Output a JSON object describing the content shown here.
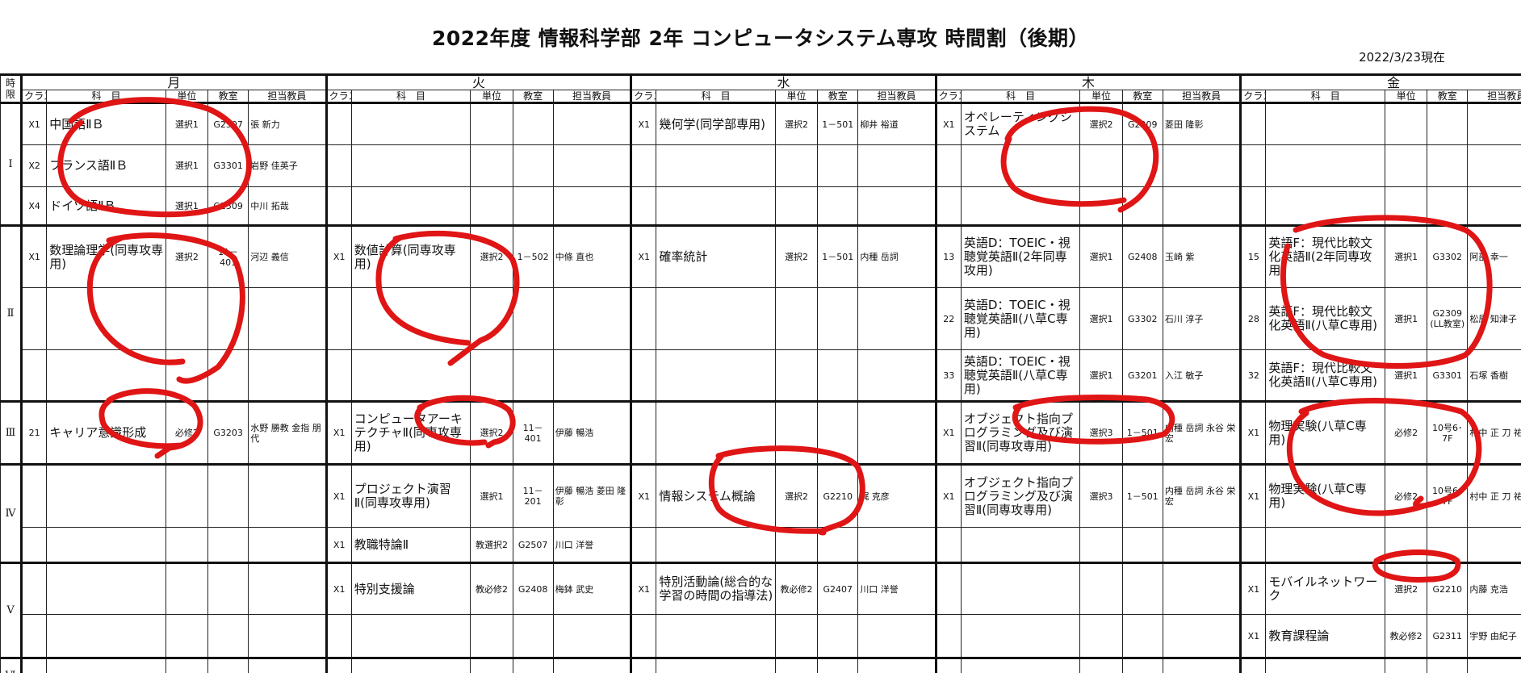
{
  "title": "2022年度 情報科学部 2年 コンピュータシステム専攻 時間割（後期）",
  "as_of": "2022/3/23現在",
  "header": {
    "period_label": "時限",
    "days": [
      "月",
      "火",
      "水",
      "木",
      "金"
    ],
    "cols": {
      "class": "クラス",
      "subject": "科　目",
      "units": "単位",
      "room": "教室",
      "teacher": "担当教員"
    }
  },
  "periods": [
    {
      "label": "Ⅰ",
      "rows": [
        [
          {
            "cls": "X1",
            "subject": "中国語ⅡＢ",
            "units": "選択1",
            "room": "G2507",
            "teacher": "張 新力"
          },
          {},
          {
            "cls": "X1",
            "subject": "幾何学(同学部専用)",
            "units": "選択2",
            "room": "1－501",
            "teacher": "柳井 裕道"
          },
          {
            "cls": "X1",
            "subject": "オペレーティングシステム",
            "units": "選択2",
            "room": "G2209",
            "teacher": "菱田 隆彰"
          },
          {}
        ],
        [
          {
            "cls": "X2",
            "subject": "フランス語ⅡＢ",
            "units": "選択1",
            "room": "G3301",
            "teacher": "岩野 佳英子"
          },
          {},
          {},
          {},
          {}
        ],
        [
          {
            "cls": "X4",
            "subject": "ドイツ語ⅡＢ",
            "units": "選択1",
            "room": "G2509",
            "teacher": "中川 拓哉"
          },
          {},
          {},
          {},
          {}
        ]
      ]
    },
    {
      "label": "Ⅱ",
      "rows": [
        [
          {
            "cls": "X1",
            "subject": "数理論理学(同専攻専用)",
            "units": "選択2",
            "room": "11－401",
            "teacher": "河辺 義信"
          },
          {
            "cls": "X1",
            "subject": "数値計算(同専攻専用)",
            "units": "選択2",
            "room": "1－502",
            "teacher": "中條 直也"
          },
          {
            "cls": "X1",
            "subject": "確率統計",
            "units": "選択2",
            "room": "1－501",
            "teacher": "内種 岳詞"
          },
          {
            "cls": "13",
            "subject": "英語D：TOEIC・視聴覚英語Ⅱ(2年同専攻用)",
            "units": "選択1",
            "room": "G2408",
            "teacher": "玉崎 紫"
          },
          {
            "cls": "15",
            "subject": "英語F：現代比較文化英語Ⅱ(2年同専攻用)",
            "units": "選択1",
            "room": "G3302",
            "teacher": "阿部 幸一"
          }
        ],
        [
          {},
          {},
          {},
          {
            "cls": "22",
            "subject": "英語D：TOEIC・視聴覚英語Ⅱ(八草C専用)",
            "units": "選択1",
            "room": "G3302",
            "teacher": "石川 淳子"
          },
          {
            "cls": "28",
            "subject": "英語F：現代比較文化英語Ⅱ(八草C専用)",
            "units": "選択1",
            "room": "G2309 (LL教室)",
            "teacher": "松原 知津子"
          }
        ],
        [
          {},
          {},
          {},
          {
            "cls": "33",
            "subject": "英語D：TOEIC・視聴覚英語Ⅱ(八草C専用)",
            "units": "選択1",
            "room": "G3201",
            "teacher": "入江 敏子"
          },
          {
            "cls": "32",
            "subject": "英語F：現代比較文化英語Ⅱ(八草C専用)",
            "units": "選択1",
            "room": "G3301",
            "teacher": "石塚 香樹"
          }
        ]
      ]
    },
    {
      "label": "Ⅲ",
      "rows": [
        [
          {
            "cls": "21",
            "subject": "キャリア意識形成",
            "units": "必修2",
            "room": "G3203",
            "teacher": "水野 勝教 金指 朋代"
          },
          {
            "cls": "X1",
            "subject": "コンピュータアーキテクチャⅡ(同専攻専用)",
            "units": "選択2",
            "room": "11－401",
            "teacher": "伊藤 暢浩"
          },
          {},
          {
            "cls": "X1",
            "subject": "オブジェクト指向プログラミング及び演習Ⅱ(同専攻専用)",
            "units": "選択3",
            "room": "1－501",
            "teacher": "内種 岳詞 永谷 栄宏"
          },
          {
            "cls": "X1",
            "subject": "物理実験(八草C専用)",
            "units": "必修2",
            "room": "10号6･7F",
            "teacher": "村中 正 刀 祐一"
          }
        ]
      ]
    },
    {
      "label": "Ⅳ",
      "rows": [
        [
          {},
          {
            "cls": "X1",
            "subject": "プロジェクト演習Ⅱ(同専攻専用)",
            "units": "選択1",
            "room": "11－201",
            "teacher": "伊藤 暢浩 菱田 隆彰"
          },
          {
            "cls": "X1",
            "subject": "情報システム概論",
            "units": "選択2",
            "room": "G2210",
            "teacher": "梶 克彦"
          },
          {
            "cls": "X1",
            "subject": "オブジェクト指向プログラミング及び演習Ⅱ(同専攻専用)",
            "units": "選択3",
            "room": "1－501",
            "teacher": "内種 岳詞 永谷 栄宏"
          },
          {
            "cls": "X1",
            "subject": "物理実験(八草C専用)",
            "units": "必修2",
            "room": "10号6･7F",
            "teacher": "村中 正 刀 祐一"
          }
        ],
        [
          {},
          {
            "cls": "X1",
            "subject": "教職特論Ⅱ",
            "units": "教選択2",
            "room": "G2507",
            "teacher": "川口 洋誉"
          },
          {},
          {},
          {}
        ]
      ]
    },
    {
      "label": "Ⅴ",
      "rows": [
        [
          {},
          {
            "cls": "X1",
            "subject": "特別支援論",
            "units": "教必修2",
            "room": "G2408",
            "teacher": "梅鉢 武史"
          },
          {
            "cls": "X1",
            "subject": "特別活動論(総合的な学習の時間の指導法)",
            "units": "教必修2",
            "room": "G2407",
            "teacher": "川口 洋誉"
          },
          {},
          {
            "cls": "X1",
            "subject": "モバイルネットワーク",
            "units": "選択2",
            "room": "G2210",
            "teacher": "内藤 克浩"
          }
        ],
        [
          {},
          {},
          {},
          {},
          {
            "cls": "X1",
            "subject": "教育課程論",
            "units": "教必修2",
            "room": "G2311",
            "teacher": "宇野 由紀子"
          }
        ]
      ]
    },
    {
      "label": "Ⅵ",
      "rows": [
        [
          {},
          {},
          {},
          {},
          {}
        ]
      ]
    }
  ],
  "annotation_color": "#e01515"
}
